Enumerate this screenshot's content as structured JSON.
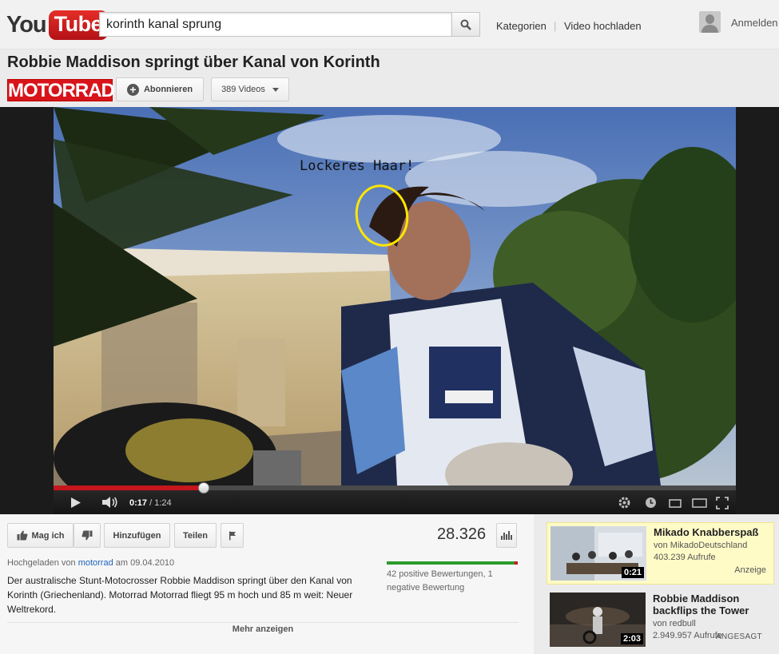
{
  "masthead": {
    "logo_you": "You",
    "logo_tube": "Tube",
    "search_value": "korinth kanal sprung",
    "nav": [
      "Kategorien",
      "Video hochladen"
    ],
    "signin": "Anmelden"
  },
  "video": {
    "title": "Robbie Maddison springt über Kanal von Korinth",
    "channel_logo_text": "MOTORRAD",
    "subscribe_label": "Abonnieren",
    "videos_label": "389 Videos",
    "annotation_text": "Lockeres Haar!",
    "annotation_color": "#ffe600",
    "current_time": "0:17",
    "separator": "/",
    "duration": "1:24",
    "progress": 0.22,
    "buffered": 0.22
  },
  "actions": {
    "like_label": "Mag ich",
    "add_label": "Hinzufügen",
    "share_label": "Teilen",
    "view_count": "28.326",
    "rating_text": "42 positive Bewertungen, 1 negative Bewertung",
    "like_ratio": 0.977
  },
  "details": {
    "uploaded_prefix": "Hochgeladen von",
    "uploader": "motorrad",
    "uploaded_date": "am 09.04.2010",
    "description": "Der australische Stunt-Motocrosser Robbie Maddison springt über den Kanal von Korinth (Griechenland). Motorrad Motorrad fliegt 95 m hoch und 85 m weit: Neuer Weltrekord.",
    "more_label": "Mehr anzeigen"
  },
  "related": [
    {
      "title": "Mikado Knabberspaß",
      "by": "von MikadoDeutschland",
      "views": "403.239 Aufrufe",
      "duration": "0:21",
      "badge": "Anzeige"
    },
    {
      "title": "Robbie Maddison backflips the Tower",
      "by": "von redbull",
      "views": "2.949.957 Aufrufe",
      "duration": "2:03",
      "badge": "ANGESAGT"
    }
  ],
  "colors": {
    "brand_red": "#cc181e",
    "progress_red": "#c4161c",
    "link_blue": "#1c62b9",
    "like_green": "#2b9b2b",
    "ad_background": "#fffbc7"
  }
}
